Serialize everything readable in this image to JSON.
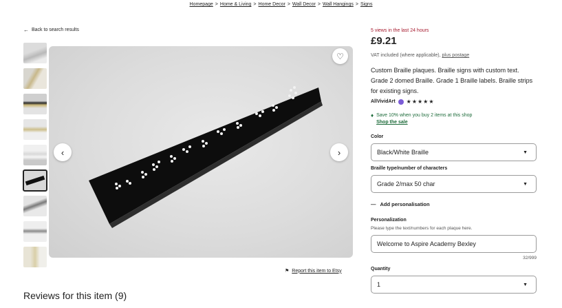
{
  "breadcrumb": [
    "Homepage",
    "Home & Living",
    "Home Decor",
    "Wall Decor",
    "Wall Hangings",
    "Signs"
  ],
  "back_link": "Back to search results",
  "report_link": "Report this item to Etsy",
  "reviews_title": "Reviews for this item (9)",
  "icons": {
    "back": "arrow-left-icon",
    "favorite": "heart-icon",
    "prev": "chevron-left-icon",
    "next": "chevron-right-icon",
    "report": "flag-icon",
    "promo": "tag-icon",
    "dropdown": "caret-down-icon",
    "collapse": "minus-icon"
  },
  "listing": {
    "views": "5 views in the last 24 hours",
    "price": "£9.21",
    "vat_text": "VAT included (where applicable),",
    "vat_link": "plus postage",
    "description": "Custom Braille plaques. Braille signs with custom text. Grade 2 domed Braille. Grade 1 Braille labels. Braille strips for existing signs.",
    "shop_name": "AllVividArt",
    "stars": "★★★★★",
    "promo_text": "Save 10% when you buy 2 items at this shop",
    "promo_link": "Shop the sale",
    "color_label": "Color",
    "color_value": "Black/White Braille",
    "braille_label": "Braille type/number of characters",
    "braille_value": "Grade 2/max 50 char",
    "add_personalisation": "Add personalisation",
    "personalization_label": "Personalization",
    "personalization_hint": "Please type the text/numbers for each plaque here.",
    "personalization_value": "Welcome to Aspire Academy Bexley",
    "personalization_counter": "32/999",
    "quantity_label": "Quantity",
    "quantity_value": "1"
  },
  "colors": {
    "views_red": "#a61a2e",
    "promo_green": "#1d6b3a",
    "badge_purple": "#7b5cd6"
  }
}
